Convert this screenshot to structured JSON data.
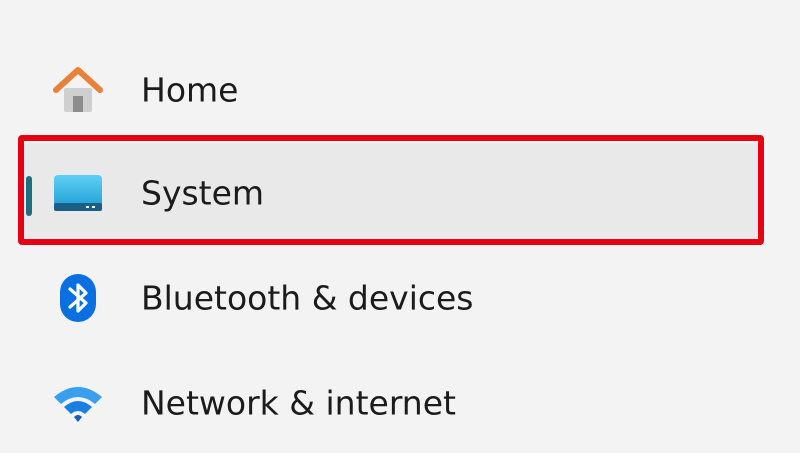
{
  "colors": {
    "accent": "#0067c0",
    "indicator": "#1f6e86",
    "highlight": "#e60012",
    "home_roof": "#e8823a",
    "home_body": "#c9c9c9",
    "system_monitor": "#25aee0",
    "bluetooth": "#0a6fe0",
    "wifi": "#1a7fe3"
  },
  "nav": {
    "items": [
      {
        "label": "Home",
        "icon": "home-icon",
        "selected": false
      },
      {
        "label": "System",
        "icon": "monitor-icon",
        "selected": true
      },
      {
        "label": "Bluetooth & devices",
        "icon": "bluetooth-icon",
        "selected": false
      },
      {
        "label": "Network & internet",
        "icon": "wifi-icon",
        "selected": false
      }
    ]
  }
}
